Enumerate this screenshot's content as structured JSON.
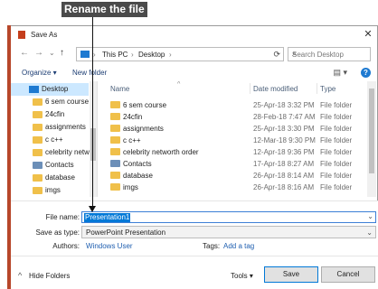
{
  "callout": {
    "text": "Rename the file"
  },
  "window": {
    "title": "Save As",
    "close_glyph": "✕"
  },
  "nav": {
    "back": "←",
    "forward": "→",
    "up_dropdown": "⌄",
    "up": "↑",
    "breadcrumb": [
      "This PC",
      "Desktop"
    ],
    "separator": "›",
    "refresh": "⟳",
    "search_placeholder": "Search Desktop",
    "search_glyph": "⌕"
  },
  "toolbar": {
    "organize": "Organize ▾",
    "new_folder": "New folder",
    "view": "▤ ▾",
    "help": "?"
  },
  "sidebar": {
    "items": [
      {
        "label": "Desktop",
        "icon": "desktop-icon",
        "active": true
      },
      {
        "label": "6 sem course",
        "icon": "folder-icon"
      },
      {
        "label": "24cfin",
        "icon": "folder-icon"
      },
      {
        "label": "assignments",
        "icon": "folder-icon"
      },
      {
        "label": "c c++",
        "icon": "folder-icon"
      },
      {
        "label": "celebrity networ",
        "icon": "folder-icon"
      },
      {
        "label": "Contacts",
        "icon": "contacts-icon"
      },
      {
        "label": "database",
        "icon": "folder-icon"
      },
      {
        "label": "imgs",
        "icon": "folder-icon"
      }
    ]
  },
  "filelist": {
    "columns": [
      "Name",
      "Date modified",
      "Type"
    ],
    "sort_indicator": "^",
    "rows": [
      {
        "name": "6 sem course",
        "date": "25-Apr-18 3:32 PM",
        "type": "File folder",
        "icon": "folder-icon"
      },
      {
        "name": "24cfin",
        "date": "28-Feb-18 7:47 AM",
        "type": "File folder",
        "icon": "folder-icon"
      },
      {
        "name": "assignments",
        "date": "25-Apr-18 3:30 PM",
        "type": "File folder",
        "icon": "folder-icon"
      },
      {
        "name": "c c++",
        "date": "12-Mar-18 9:30 PM",
        "type": "File folder",
        "icon": "folder-icon"
      },
      {
        "name": "celebrity networth order",
        "date": "12-Apr-18 9:36 PM",
        "type": "File folder",
        "icon": "folder-icon"
      },
      {
        "name": "Contacts",
        "date": "17-Apr-18 8:27 AM",
        "type": "File folder",
        "icon": "contacts-icon"
      },
      {
        "name": "database",
        "date": "26-Apr-18 8:14 AM",
        "type": "File folder",
        "icon": "folder-icon"
      },
      {
        "name": "imgs",
        "date": "26-Apr-18 8:16 AM",
        "type": "File folder",
        "icon": "folder-icon"
      }
    ]
  },
  "form": {
    "file_name_label": "File name:",
    "file_name_value": "Presentation1",
    "save_type_label": "Save as type:",
    "save_type_value": "PowerPoint Presentation",
    "dropdown_glyph": "⌄",
    "authors_label": "Authors:",
    "authors_value": "Windows User",
    "tags_label": "Tags:",
    "tags_value": "Add a tag",
    "hide_chevron": "^",
    "hide_folders": "Hide Folders",
    "tools": "Tools ▾",
    "save": "Save",
    "cancel": "Cancel"
  },
  "colors": {
    "accent": "#0078d7",
    "powerpoint": "#b7472a",
    "folder": "#f0c04a",
    "selection": "#cce8ff"
  }
}
